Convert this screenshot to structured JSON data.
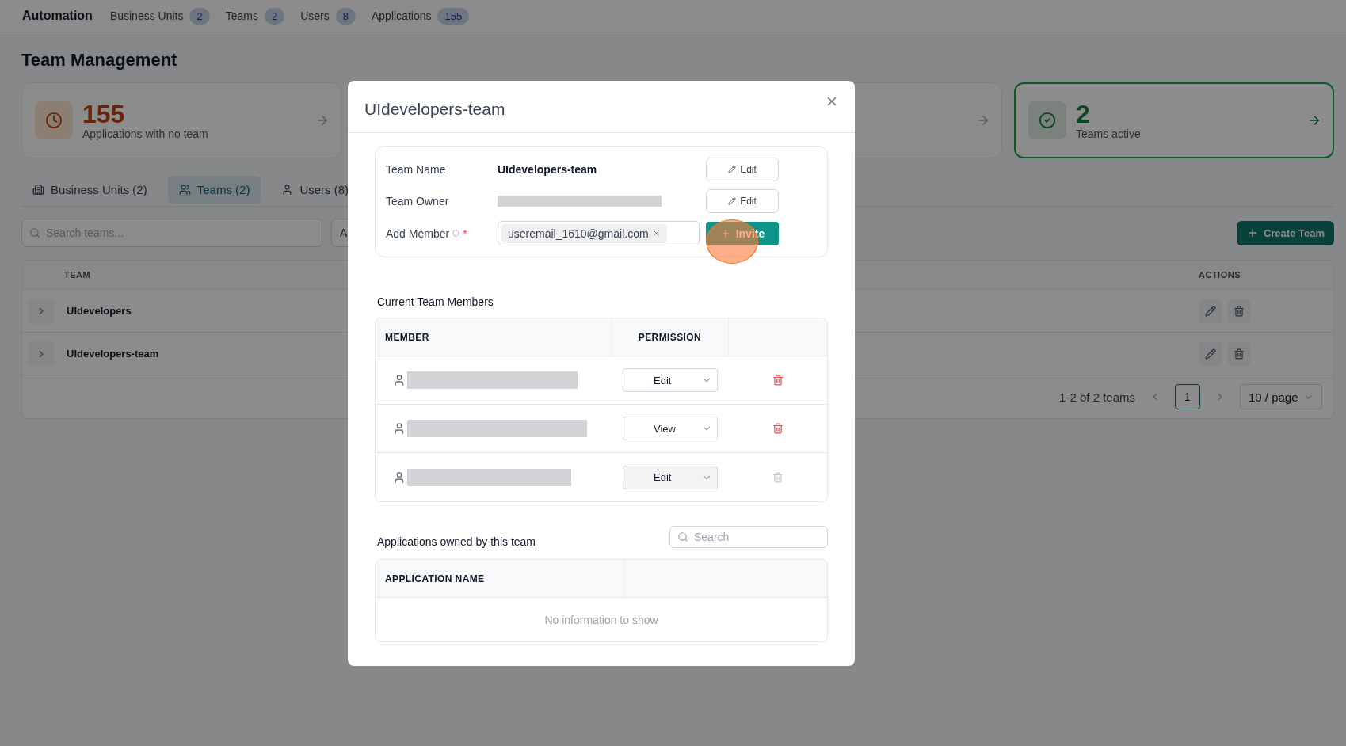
{
  "top_nav": {
    "brand": "Automation",
    "items": [
      {
        "label": "Business Units",
        "count": "2"
      },
      {
        "label": "Teams",
        "count": "2"
      },
      {
        "label": "Users",
        "count": "8"
      },
      {
        "label": "Applications",
        "count": "155"
      }
    ]
  },
  "page_title": "Team Management",
  "stat_cards": [
    {
      "kind": "warning",
      "value": "155",
      "label": "Applications with no team",
      "highlighted": false
    },
    {
      "kind": "neutral",
      "highlighted": false
    },
    {
      "kind": "success",
      "value": "2",
      "label": "Teams active",
      "highlighted": true
    }
  ],
  "tabs": [
    {
      "label": "Business Units (2)",
      "selected": false
    },
    {
      "label": "Teams (2)",
      "selected": true
    },
    {
      "label": "Users (8)",
      "selected": false
    }
  ],
  "search": {
    "placeholder": "Search teams..."
  },
  "filter_field": {
    "value": "A"
  },
  "create_button": "Create Team",
  "table": {
    "columns": [
      "TEAM",
      "ACTIONS"
    ],
    "rows": [
      {
        "name": "UIdevelopers",
        "expanded": false
      },
      {
        "name": "UIdevelopers-team",
        "expanded": false
      }
    ]
  },
  "pagination": {
    "summary": "1-2 of 2 teams",
    "pages": [
      {
        "label": "1",
        "selected": true
      }
    ],
    "page_size": "10 / page"
  },
  "modal": {
    "title": "UIdevelopers-team",
    "fields": [
      {
        "kind": "text",
        "label": "Team Name",
        "value": "UIdevelopers-team",
        "action": "Edit"
      },
      {
        "kind": "redacted",
        "label": "Team Owner",
        "action": "Edit"
      },
      {
        "kind": "tags",
        "label": "Add Member",
        "required_mark": "*",
        "tags": [
          "useremail_1610@gmail.com"
        ],
        "action": "Invite"
      }
    ],
    "members_title": "Current Team Members",
    "members_columns": [
      "MEMBER",
      "PERMISSION"
    ],
    "members": [
      {
        "permission": "Edit",
        "disabled": false
      },
      {
        "permission": "View",
        "disabled": false
      },
      {
        "permission": "Edit",
        "disabled": true
      }
    ],
    "apps_title": "Applications owned by this team",
    "apps_search": {
      "placeholder": "Search"
    },
    "apps_columns": [
      "APPLICATION NAME"
    ],
    "apps_empty": "No information to show"
  }
}
